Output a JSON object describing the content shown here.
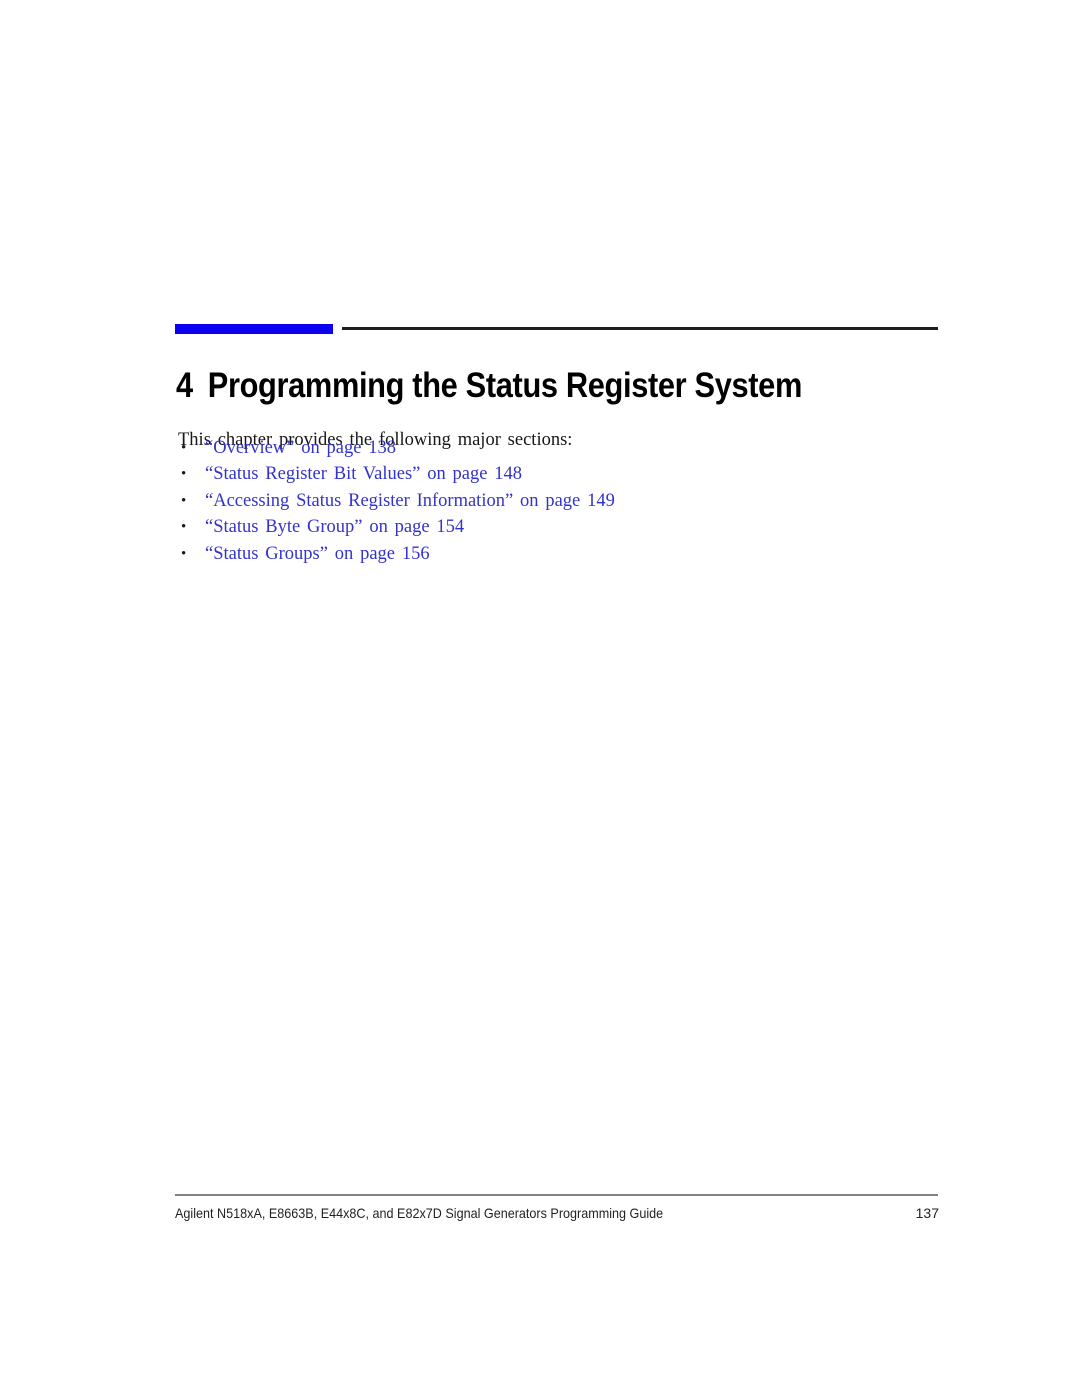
{
  "document": {
    "background_color": "#ffffff",
    "accent_blue": "#0a00f2",
    "link_blue": "#3333cc",
    "rule_black": "#231f20",
    "rule_gray": "#808285"
  },
  "chapter": {
    "number": "4",
    "title": "Programming the Status Register System"
  },
  "intro": {
    "text": "This chapter provides the following major sections:"
  },
  "toc": {
    "bullet_glyph": "•",
    "items": [
      {
        "label": "“Overview” on page  138"
      },
      {
        "label": "“Status Register Bit Values” on page  148"
      },
      {
        "label": "“Accessing Status Register Information” on page  149"
      },
      {
        "label": "“Status Byte Group” on page  154"
      },
      {
        "label": "“Status Groups” on page  156"
      }
    ]
  },
  "footer": {
    "text": "Agilent N518xA, E8663B, E44x8C, and E82x7D Signal Generators Programming Guide",
    "page_number": "137"
  }
}
